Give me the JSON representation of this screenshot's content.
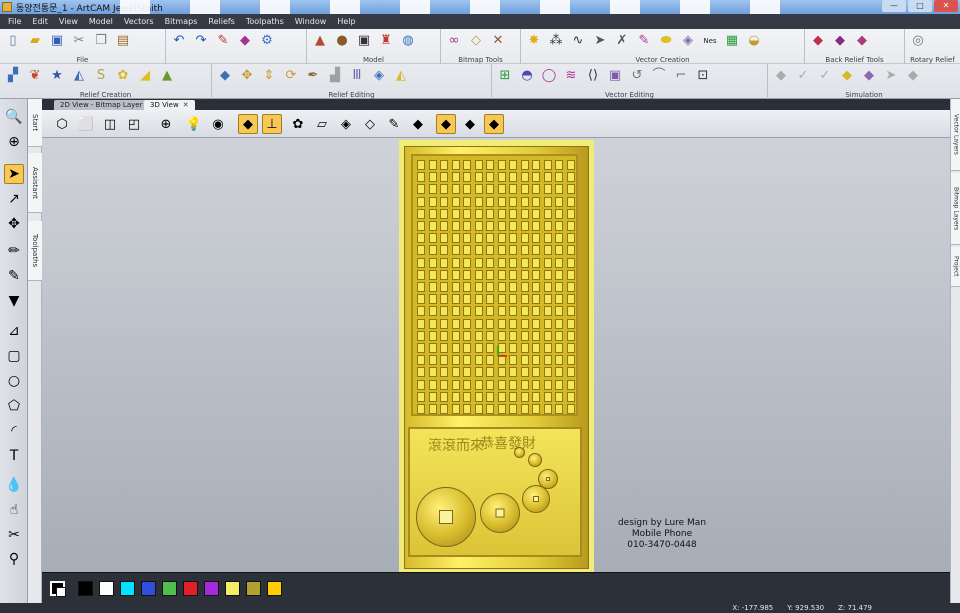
{
  "window": {
    "title": "동양전통문_1 - ArtCAM JewelSmith"
  },
  "menu": [
    "File",
    "Edit",
    "View",
    "Model",
    "Vectors",
    "Bitmaps",
    "Reliefs",
    "Toolpaths",
    "Window",
    "Help"
  ],
  "ribbon": {
    "row1": [
      {
        "label": "File"
      },
      {
        "label": "Model"
      },
      {
        "label": "Bitmap Tools"
      },
      {
        "label": "Vector Creation"
      },
      {
        "label": "Back Relief Tools"
      },
      {
        "label": "Rotary Relief"
      }
    ],
    "row2": [
      {
        "label": "Relief Creation"
      },
      {
        "label": "Relief Editing"
      },
      {
        "label": "Vector Editing"
      },
      {
        "label": "Simulation"
      }
    ]
  },
  "side_tabs": [
    "Start",
    "Assistant",
    "Toolpaths"
  ],
  "right_tabs": [
    "Vector Layers",
    "Bitmap Layers",
    "Project"
  ],
  "doc_tabs": [
    {
      "label": "2D View - Bitmap Layer",
      "active": false
    },
    {
      "label": "3D View",
      "active": true
    }
  ],
  "overlay": {
    "line1": "design by Lure Man",
    "line2": "Mobile Phone",
    "line3": "010-3470-0448"
  },
  "carving_text": [
    "恭喜發財",
    "滾滾而來"
  ],
  "palette": [
    "#000000",
    "#ffffff",
    "#00e5ff",
    "#2f4fd8",
    "#4fc04f",
    "#e01f2a",
    "#a52ad9",
    "#f4ee66",
    "#b1a12e",
    "#ffcc00"
  ],
  "status": {
    "x": "X: -177.985",
    "y": "Y: 929.530",
    "z": "Z: 71.479"
  },
  "accent": "#f6c957"
}
